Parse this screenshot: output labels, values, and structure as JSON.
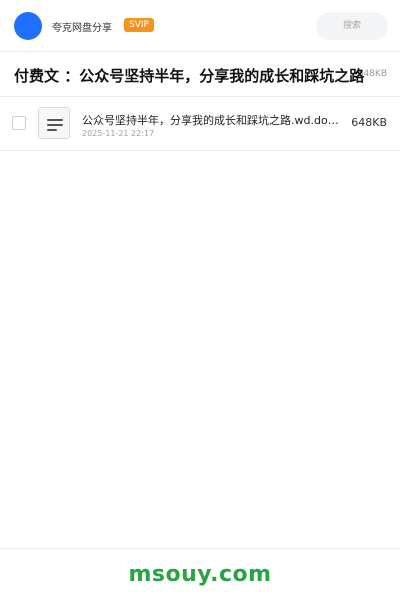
{
  "header": {
    "account_name": "夸克网盘分享",
    "badge": "SVIP",
    "search_placeholder": "搜索"
  },
  "share": {
    "title": "付费文 ：公众号坚持半年，分享我的成长和踩坑之路",
    "title_size": "648KB"
  },
  "files": [
    {
      "name": "公众号坚持半年，分享我的成长和踩坑之路.wd.docx",
      "date": "2025-11-21 22:17",
      "size": "648KB",
      "icon": "document-icon"
    }
  ],
  "footer": {
    "brand": "msouy.com"
  },
  "colors": {
    "avatar": "#1f6fff",
    "badge": "#f7941d",
    "brand": "#2aa345"
  }
}
